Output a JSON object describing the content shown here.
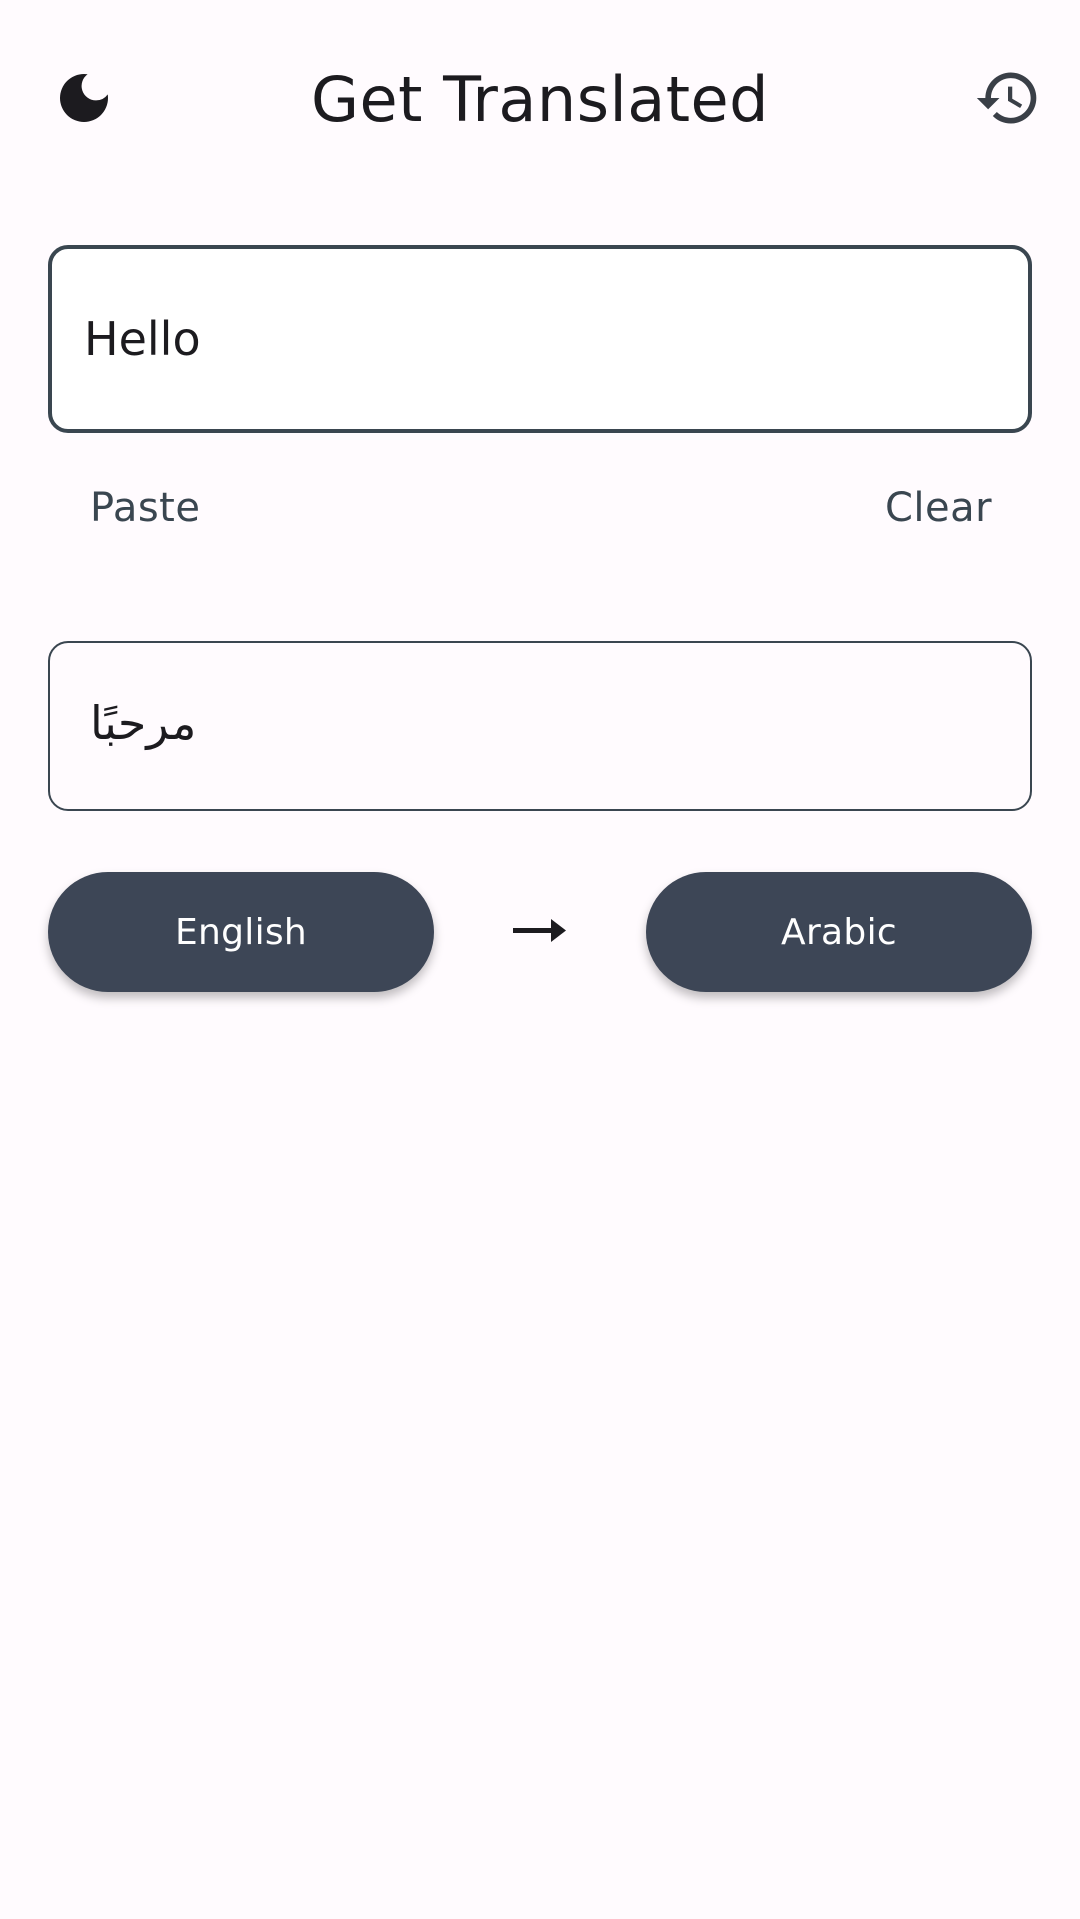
{
  "header": {
    "title": "Get Translated",
    "left_icon": "moon-icon",
    "right_icon": "history-icon"
  },
  "input": {
    "value": "Hello"
  },
  "actions": {
    "paste_label": "Paste",
    "clear_label": "Clear"
  },
  "output": {
    "text": "مرحبًا"
  },
  "languages": {
    "source": "English",
    "target": "Arabic",
    "arrow_icon": "arrow-right-icon"
  },
  "colors": {
    "background": "#fffbfe",
    "button": "#3d4656",
    "border": "#3a4650",
    "text": "#1c1b1f"
  }
}
